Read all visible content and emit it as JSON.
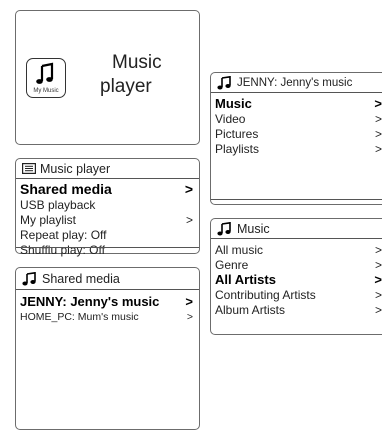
{
  "splash": {
    "icon_label": "My Music",
    "title_line1": "Music",
    "title_line2": "player"
  },
  "music_player_menu": {
    "title": "Music player",
    "items": [
      {
        "label": "Shared media",
        "arrow": ">"
      },
      {
        "label": "USB playback",
        "arrow": ""
      },
      {
        "label": "My playlist",
        "arrow": ">"
      },
      {
        "label": "Repeat play: Off",
        "arrow": ""
      },
      {
        "label": "Shufflu play: Off",
        "arrow": ""
      }
    ]
  },
  "shared_media_menu": {
    "title": "Shared media",
    "items": [
      {
        "label": "JENNY: Jenny's music",
        "arrow": ">"
      },
      {
        "label": "HOME_PC: Mum's music",
        "arrow": ">"
      }
    ]
  },
  "jenny_menu": {
    "title": "JENNY: Jenny's music",
    "items": [
      {
        "label": "Music",
        "arrow": ">"
      },
      {
        "label": "Video",
        "arrow": ">"
      },
      {
        "label": "Pictures",
        "arrow": ">"
      },
      {
        "label": "Playlists",
        "arrow": ">"
      }
    ]
  },
  "music_menu": {
    "title": "Music",
    "items": [
      {
        "label": "All music",
        "arrow": ">"
      },
      {
        "label": "Genre",
        "arrow": ">"
      },
      {
        "label": "All Artists",
        "arrow": ">"
      },
      {
        "label": "Contributing Artists",
        "arrow": ">"
      },
      {
        "label": "Album Artists",
        "arrow": ">"
      }
    ]
  }
}
